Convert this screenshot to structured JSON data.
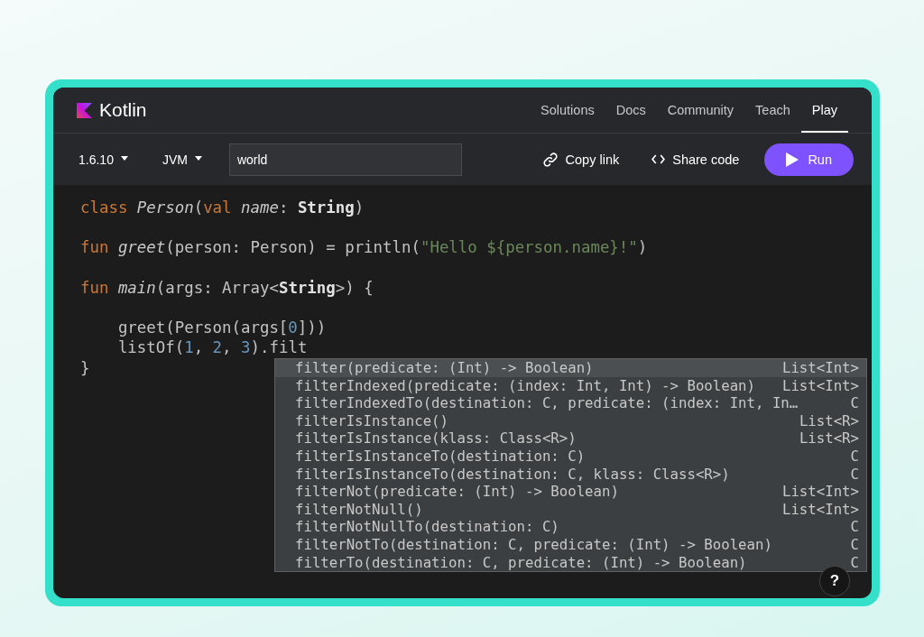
{
  "header": {
    "logo": "Kotlin",
    "nav": [
      {
        "label": "Solutions",
        "selected": false
      },
      {
        "label": "Docs",
        "selected": false
      },
      {
        "label": "Community",
        "selected": false
      },
      {
        "label": "Teach",
        "selected": false
      },
      {
        "label": "Play",
        "selected": true
      }
    ]
  },
  "toolbar": {
    "version": "1.6.10",
    "platform": "JVM",
    "program_args": "world",
    "copy_link": "Copy link",
    "share_code": "Share code",
    "run": "Run"
  },
  "code_blocks": [
    [
      [
        {
          "t": "class ",
          "kind": "keyword"
        },
        {
          "t": "Person",
          "kind": "italic"
        },
        {
          "t": "(",
          "kind": "plain"
        },
        {
          "t": "val ",
          "kind": "keyword"
        },
        {
          "t": "name",
          "kind": "italic"
        },
        {
          "t": ": ",
          "kind": "plain"
        },
        {
          "t": "String",
          "kind": "type"
        },
        {
          "t": ")",
          "kind": "plain"
        }
      ]
    ],
    [
      [
        {
          "t": "fun ",
          "kind": "keyword"
        },
        {
          "t": "greet",
          "kind": "italic"
        },
        {
          "t": "(person: Person) = println(",
          "kind": "plain"
        },
        {
          "t": "\"Hello ${person.name}!\"",
          "kind": "string"
        },
        {
          "t": ")",
          "kind": "plain"
        }
      ]
    ],
    [
      [
        {
          "t": "fun ",
          "kind": "keyword"
        },
        {
          "t": "main",
          "kind": "italic"
        },
        {
          "t": "(args: Array<",
          "kind": "plain"
        },
        {
          "t": "String",
          "kind": "type"
        },
        {
          "t": ">) {",
          "kind": "plain"
        }
      ]
    ],
    [
      [
        {
          "t": "    greet(Person(args[",
          "kind": "plain"
        },
        {
          "t": "0",
          "kind": "number"
        },
        {
          "t": "]))",
          "kind": "plain"
        }
      ],
      [
        {
          "t": "    listOf(",
          "kind": "plain"
        },
        {
          "t": "1",
          "kind": "number"
        },
        {
          "t": ", ",
          "kind": "plain"
        },
        {
          "t": "2",
          "kind": "number"
        },
        {
          "t": ", ",
          "kind": "plain"
        },
        {
          "t": "3",
          "kind": "number"
        },
        {
          "t": ").filt",
          "kind": "plain"
        }
      ],
      [
        {
          "t": "}",
          "kind": "plain"
        }
      ]
    ]
  ],
  "completion": [
    {
      "signature": "filter(predicate: (Int) -> Boolean)",
      "type": "List<Int>",
      "selected": true
    },
    {
      "signature": "filterIndexed(predicate: (index: Int, Int) -> Boolean)",
      "type": "List<Int>",
      "selected": false
    },
    {
      "signature": "filterIndexedTo(destination: C, predicate: (index: Int, In…",
      "type": "C",
      "selected": false
    },
    {
      "signature": "filterIsInstance()",
      "type": "List<R>",
      "selected": false
    },
    {
      "signature": "filterIsInstance(klass: Class<R>)",
      "type": "List<R>",
      "selected": false
    },
    {
      "signature": "filterIsInstanceTo(destination: C)",
      "type": "C",
      "selected": false
    },
    {
      "signature": "filterIsInstanceTo(destination: C, klass: Class<R>)",
      "type": "C",
      "selected": false
    },
    {
      "signature": "filterNot(predicate: (Int) -> Boolean)",
      "type": "List<Int>",
      "selected": false
    },
    {
      "signature": "filterNotNull()",
      "type": "List<Int>",
      "selected": false
    },
    {
      "signature": "filterNotNullTo(destination: C)",
      "type": "C",
      "selected": false
    },
    {
      "signature": "filterNotTo(destination: C, predicate: (Int) -> Boolean)",
      "type": "C",
      "selected": false
    },
    {
      "signature": "filterTo(destination: C, predicate: (Int) -> Boolean)",
      "type": "C",
      "selected": false
    }
  ],
  "help": "?"
}
